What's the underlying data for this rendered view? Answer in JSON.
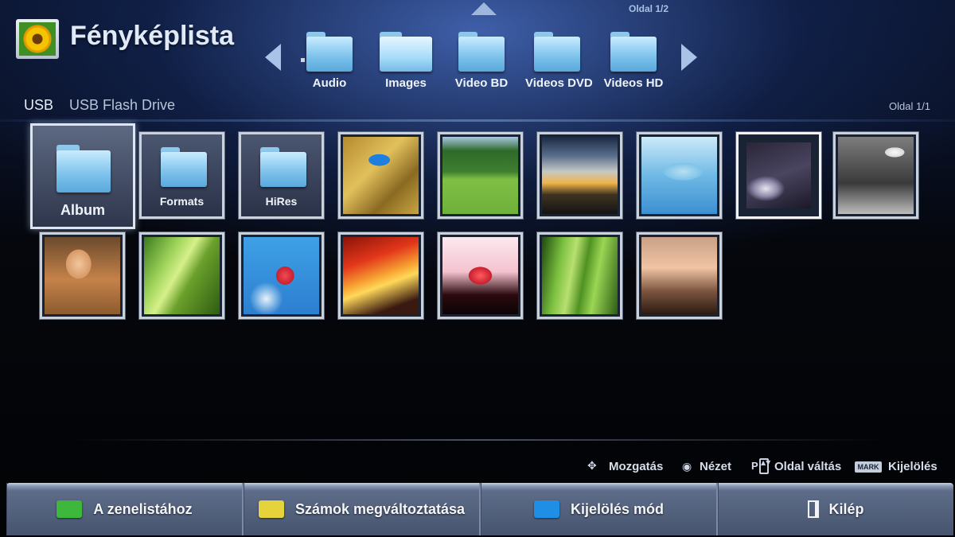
{
  "header": {
    "title": "Fényképlista",
    "page_indicator": "Oldal 1/2",
    "folders": [
      {
        "label": "Audio",
        "open": false
      },
      {
        "label": "Images",
        "open": true
      },
      {
        "label": "Video BD",
        "open": false
      },
      {
        "label": "Videos DVD",
        "open": false
      },
      {
        "label": "Videos HD",
        "open": false
      }
    ]
  },
  "location": {
    "device": "USB",
    "drive": "USB Flash Drive",
    "page_indicator": "Oldal 1/1"
  },
  "grid": {
    "row1": [
      {
        "type": "folder",
        "label": "Album",
        "selected": true
      },
      {
        "type": "folder",
        "label": "Formats"
      },
      {
        "type": "folder",
        "label": "HiRes"
      },
      {
        "type": "photo",
        "theme": "butterfly"
      },
      {
        "type": "photo",
        "theme": "horses-meadow"
      },
      {
        "type": "photo",
        "theme": "sunset-clouds"
      },
      {
        "type": "photo",
        "theme": "dolphin"
      },
      {
        "type": "photo",
        "theme": "light-streak"
      },
      {
        "type": "photo",
        "theme": "birds-sky"
      }
    ],
    "row2": [
      {
        "type": "photo",
        "theme": "woman-portrait"
      },
      {
        "type": "photo",
        "theme": "leaf-insect"
      },
      {
        "type": "photo",
        "theme": "red-flower"
      },
      {
        "type": "photo",
        "theme": "fire"
      },
      {
        "type": "photo",
        "theme": "red-tree"
      },
      {
        "type": "photo",
        "theme": "green-grass"
      },
      {
        "type": "photo",
        "theme": "dusk-reeds"
      }
    ]
  },
  "hints": {
    "move": "Mozgatás",
    "view": "Nézet",
    "page_change": "Oldal váltás",
    "mark_badge": "MARK",
    "mark": "Kijelölés"
  },
  "buttons": {
    "green": {
      "label": "A zenelistához",
      "color": "#3db83d"
    },
    "yellow": {
      "label": "Számok megváltoztatása",
      "color": "#e4d33a"
    },
    "blue": {
      "label": "Kijelölés mód",
      "color": "#1f8fe6"
    },
    "exit": {
      "label": "Kilép"
    }
  }
}
